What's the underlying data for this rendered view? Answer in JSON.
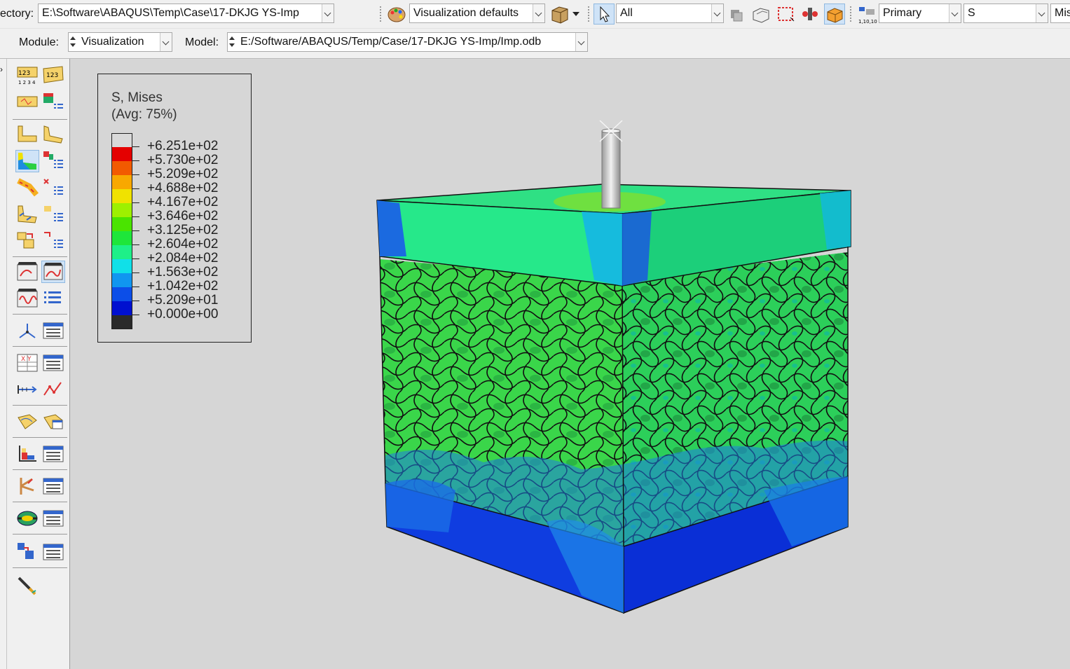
{
  "toolbar": {
    "directory_label": "ectory:",
    "directory_value": "E:\\Software\\ABAQUS\\Temp\\Case\\17-DKJG YS-Imp",
    "view_options_value": "Visualization defaults",
    "selection_filter_value": "All",
    "field_output_step": "Primary",
    "field_output_variable": "S",
    "field_output_invariant": "Mis"
  },
  "context": {
    "module_label": "Module:",
    "module_value": "Visualization",
    "model_label": "Model:",
    "model_value": "E:/Software/ABAQUS/Temp/Case/17-DKJG YS-Imp/Imp.odb"
  },
  "legend": {
    "title_line1": "S, Mises",
    "title_line2": "(Avg: 75%)",
    "entries": [
      {
        "value": "+6.251e+02",
        "color": "#d9d9d9"
      },
      {
        "value": "+5.730e+02",
        "color": "#e40000"
      },
      {
        "value": "+5.209e+02",
        "color": "#f25a00"
      },
      {
        "value": "+4.688e+02",
        "color": "#f8a800"
      },
      {
        "value": "+4.167e+02",
        "color": "#f0e200"
      },
      {
        "value": "+3.646e+02",
        "color": "#9ef000"
      },
      {
        "value": "+3.125e+02",
        "color": "#4ae400"
      },
      {
        "value": "+2.604e+02",
        "color": "#1ee63a"
      },
      {
        "value": "+2.084e+02",
        "color": "#1ef088"
      },
      {
        "value": "+1.563e+02",
        "color": "#10e0e8"
      },
      {
        "value": "+1.042e+02",
        "color": "#1096f0"
      },
      {
        "value": "+5.209e+01",
        "color": "#0c4ee8"
      },
      {
        "value": "+0.000e+00",
        "color": "#0010d0"
      }
    ],
    "bottom_color": "#2a2a2a"
  },
  "colors": {
    "accent_selected": "#cfe3f7",
    "viewport_bg": "#d6d6d6"
  }
}
